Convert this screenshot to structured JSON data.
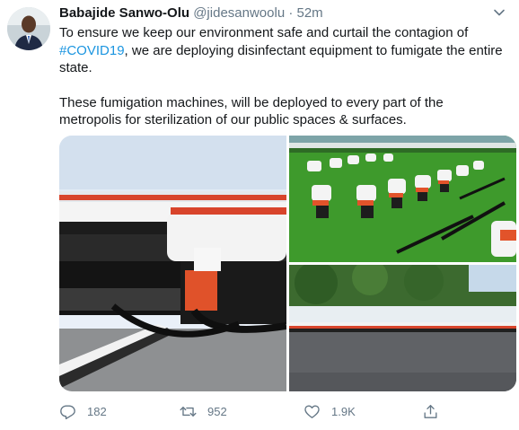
{
  "tweet": {
    "author_name": "Babajide Sanwo-Olu",
    "handle": "@jidesanwoolu",
    "separator": "·",
    "time": "52m",
    "text_line1_before": "To ensure we keep our environment safe and curtail the contagion of",
    "hashtag": "#COVID19",
    "text_line1_after": ", we are deploying disinfectant equipment to fumigate the entire state.",
    "paragraph2": "These fumigation machines, will be deployed to every part of the metropolis for sterilization of our public spaces & surfaces."
  },
  "media": {
    "photos": [
      "fumigation-machines-closeup",
      "fumigation-machines-on-lawn",
      "fumigation-machines-lined-up-by-wall"
    ]
  },
  "actions": {
    "reply": {
      "icon": "reply-icon",
      "count": "182"
    },
    "retweet": {
      "icon": "retweet-icon",
      "count": "952"
    },
    "like": {
      "icon": "heart-icon",
      "count": "1.9K"
    },
    "share": {
      "icon": "share-icon"
    }
  },
  "colors": {
    "accent": "#1b95e0",
    "muted": "#657786",
    "text": "#14171a"
  }
}
